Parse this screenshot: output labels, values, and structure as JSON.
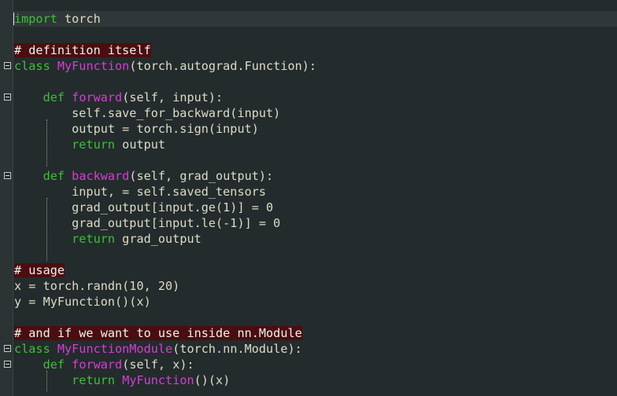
{
  "editor": {
    "code_lines": [
      [
        {
          "t": "import",
          "c": "kw"
        },
        {
          "t": " torch",
          "c": "tx"
        }
      ],
      [],
      [
        {
          "t": "# definition itself",
          "c": "cm"
        }
      ],
      [
        {
          "t": "class",
          "c": "kw"
        },
        {
          "t": " ",
          "c": "tx"
        },
        {
          "t": "MyFunction",
          "c": "fn"
        },
        {
          "t": "(torch.autograd.Function):",
          "c": "tx"
        }
      ],
      [],
      [
        {
          "t": "    ",
          "c": "tx"
        },
        {
          "t": "def",
          "c": "kw"
        },
        {
          "t": " ",
          "c": "tx"
        },
        {
          "t": "forward",
          "c": "fn"
        },
        {
          "t": "(self, input):",
          "c": "tx"
        }
      ],
      [
        {
          "t": "        self.save_for_backward(input)",
          "c": "tx"
        }
      ],
      [
        {
          "t": "        output = torch.sign(input)",
          "c": "tx"
        }
      ],
      [
        {
          "t": "        ",
          "c": "tx"
        },
        {
          "t": "return",
          "c": "kw"
        },
        {
          "t": " output",
          "c": "tx"
        }
      ],
      [],
      [
        {
          "t": "    ",
          "c": "tx"
        },
        {
          "t": "def",
          "c": "kw"
        },
        {
          "t": " ",
          "c": "tx"
        },
        {
          "t": "backward",
          "c": "fn"
        },
        {
          "t": "(self, grad_output):",
          "c": "tx"
        }
      ],
      [
        {
          "t": "        input, = self.saved_tensors",
          "c": "tx"
        }
      ],
      [
        {
          "t": "        grad_output[input.ge(1)] = 0",
          "c": "tx"
        }
      ],
      [
        {
          "t": "        grad_output[input.le(-1)] = 0",
          "c": "tx"
        }
      ],
      [
        {
          "t": "        ",
          "c": "tx"
        },
        {
          "t": "return",
          "c": "kw"
        },
        {
          "t": " grad_output",
          "c": "tx"
        }
      ],
      [],
      [
        {
          "t": "# usage",
          "c": "cm"
        }
      ],
      [
        {
          "t": "x = torch.randn(10, 20)",
          "c": "tx"
        }
      ],
      [
        {
          "t": "y = MyFunction()(x)",
          "c": "tx"
        }
      ],
      [],
      [
        {
          "t": "# and if we want to use inside nn.Module",
          "c": "cm"
        }
      ],
      [
        {
          "t": "class",
          "c": "kw"
        },
        {
          "t": " ",
          "c": "tx"
        },
        {
          "t": "MyFunctionModule",
          "c": "fn"
        },
        {
          "t": "(torch.nn.Module):",
          "c": "tx"
        }
      ],
      [
        {
          "t": "    ",
          "c": "tx"
        },
        {
          "t": "def",
          "c": "kw"
        },
        {
          "t": " ",
          "c": "tx"
        },
        {
          "t": "forward",
          "c": "fn"
        },
        {
          "t": "(self, x):",
          "c": "tx"
        }
      ],
      [
        {
          "t": "        ",
          "c": "tx"
        },
        {
          "t": "return",
          "c": "kw"
        },
        {
          "t": " ",
          "c": "tx"
        },
        {
          "t": "MyFunction",
          "c": "fn"
        },
        {
          "t": "()(x)",
          "c": "tx"
        }
      ]
    ],
    "fold_markers": [
      3,
      5,
      10,
      21,
      22
    ],
    "cursor_line": 0,
    "colors": {
      "background": "#242b2d",
      "keyword": "#3fbf38",
      "function_name": "#d33fd3",
      "plain_text": "#dcdcc4",
      "comment_highlight": "#4a0e10",
      "indent_guide": "#9a9a78"
    }
  }
}
